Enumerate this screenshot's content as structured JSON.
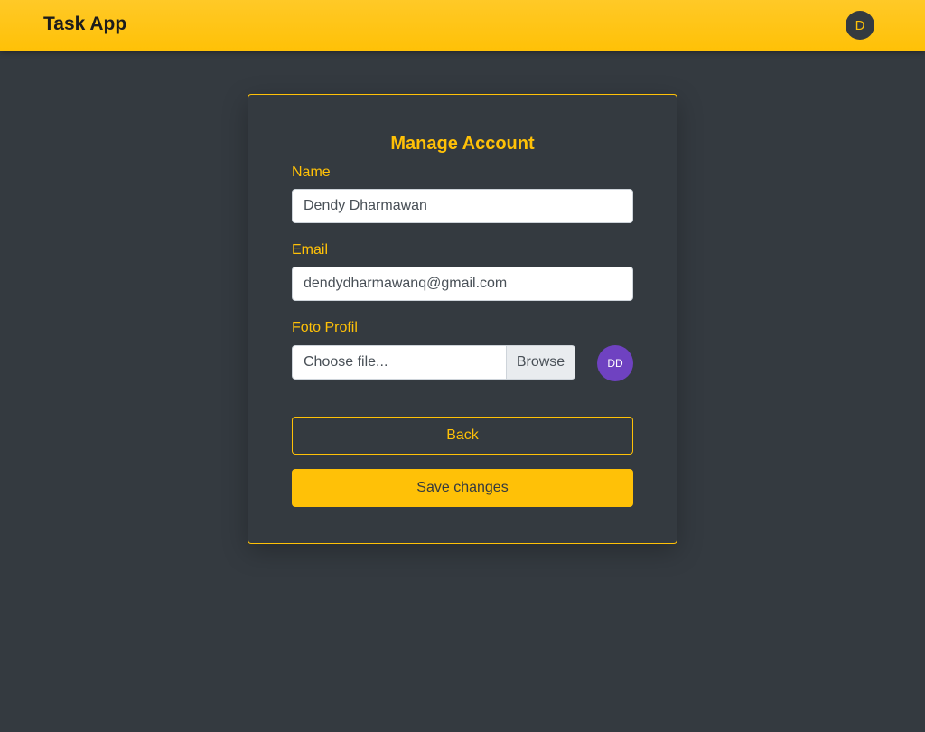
{
  "navbar": {
    "brand": "Task App",
    "avatar_initial": "D"
  },
  "form": {
    "title": "Manage Account",
    "name_label": "Name",
    "name_value": "Dendy Dharmawan",
    "email_label": "Email",
    "email_value": "dendydharmawanq@gmail.com",
    "photo_label": "Foto Profil",
    "file_placeholder": "Choose file...",
    "browse_label": "Browse",
    "profile_initials": "DD",
    "back_label": "Back",
    "save_label": "Save changes"
  },
  "colors": {
    "accent": "#ffc107",
    "background": "#343a40",
    "avatar_profile": "#6f42c1"
  }
}
